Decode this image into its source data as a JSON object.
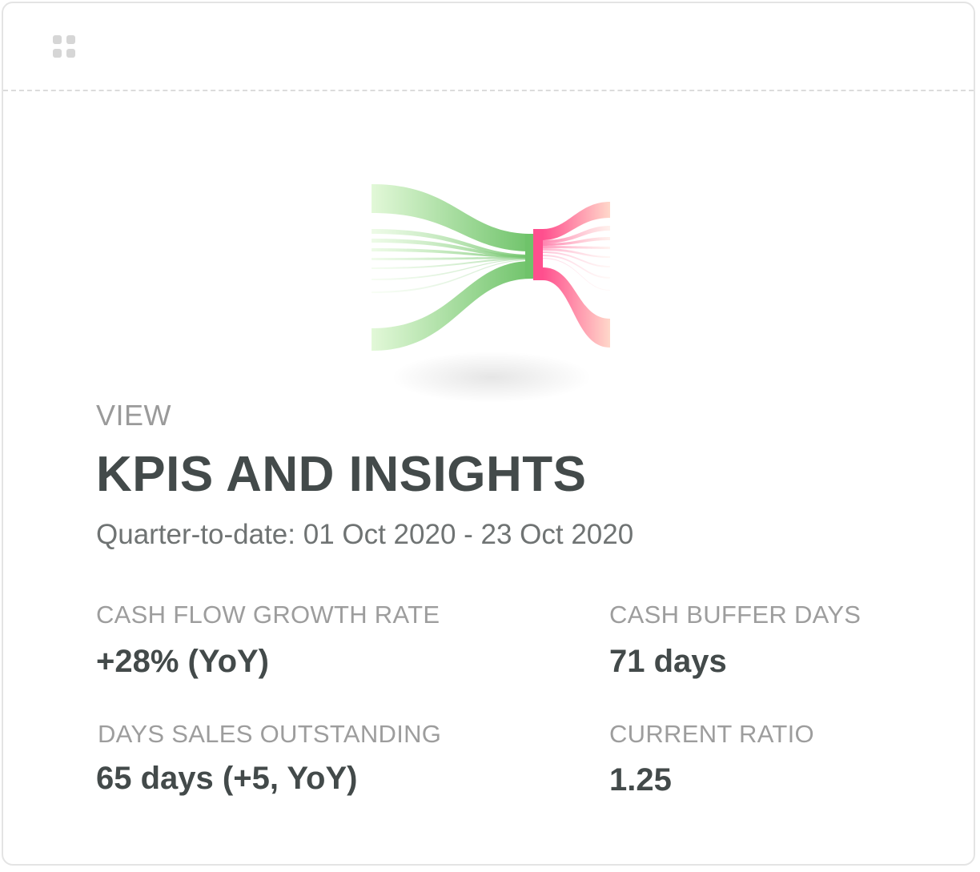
{
  "card": {
    "eyebrow": "VIEW",
    "title": "KPIS AND INSIGHTS",
    "subtitle": "Quarter-to-date: 01 Oct 2020 - 23 Oct 2020"
  },
  "kpis": [
    {
      "label": "CASH FLOW GROWTH RATE",
      "value": "+28% (YoY)"
    },
    {
      "label": "CASH BUFFER DAYS",
      "value": "71 days"
    },
    {
      "label": "DAYS SALES OUTSTANDING",
      "value": "65 days (+5, YoY)"
    },
    {
      "label": "CURRENT RATIO",
      "value": "1.25"
    }
  ],
  "colors": {
    "inflow": "#6fc36a",
    "inflow_light": "#e2f8d8",
    "outflow": "#ff4f8e",
    "outflow_light": "#ffd8ca",
    "title_text": "#434a4a",
    "label_text": "#9d9d9d"
  },
  "icons": {
    "drag_handle": "drag-handle-icon",
    "illustration": "cash-flow-sankey-illustration"
  }
}
